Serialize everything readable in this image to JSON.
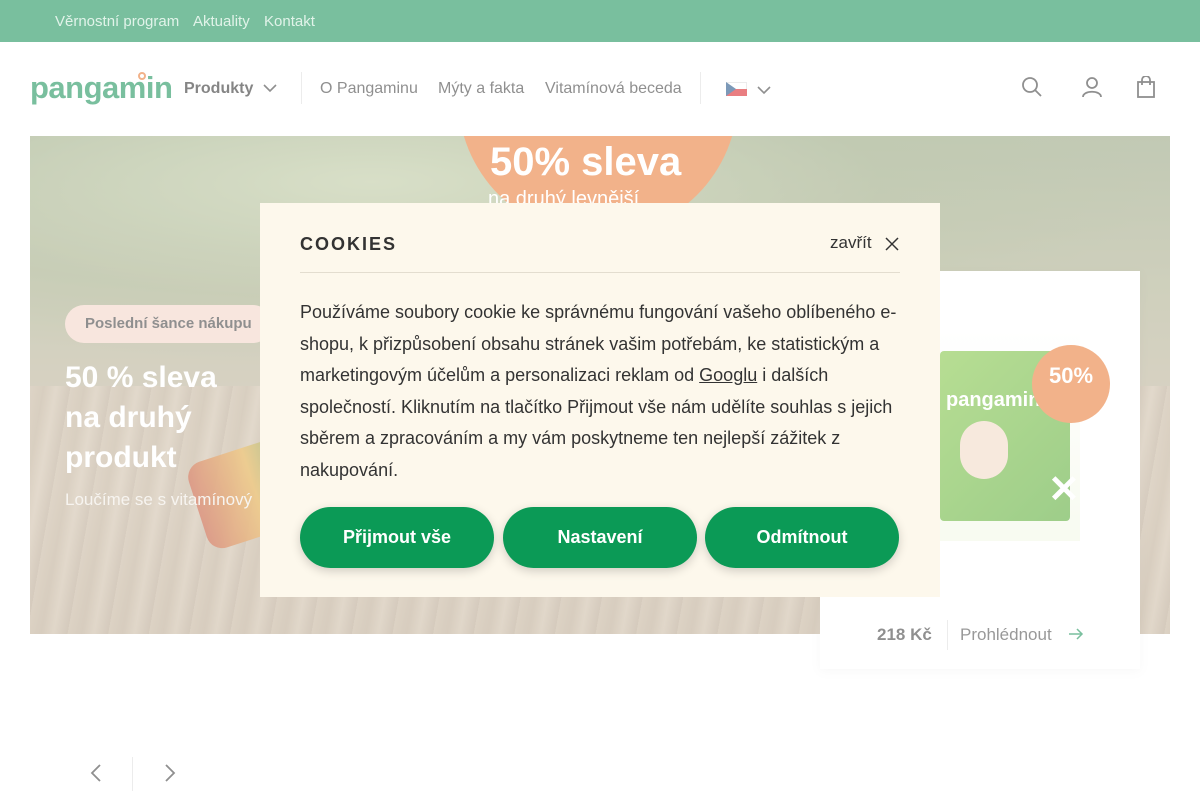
{
  "colors": {
    "brand_green": "#0b8a4f",
    "accent_orange": "#e8742a",
    "button_green": "#0b9a56",
    "modal_bg": "#fdf8ec",
    "tag_bg": "#f3d2c4"
  },
  "topbar": {
    "links": [
      "Věrnostní program",
      "Aktuality",
      "Kontakt"
    ]
  },
  "header": {
    "logo": "pangamin",
    "nav": {
      "products_label": "Produkty",
      "links": [
        "O Pangaminu",
        "Mýty a fakta",
        "Vitamínová beceda"
      ]
    },
    "language": "cs",
    "icons": [
      "search-icon",
      "user-icon",
      "cart-icon"
    ]
  },
  "hero": {
    "badge_line1": "50% sleva",
    "badge_line2": "na druhý levnější",
    "tag": "Poslední šance nákupu",
    "title_lines": [
      "50 % sleva",
      "na druhý",
      "produkt"
    ],
    "subtitle": "Loučíme se s vitamínový"
  },
  "product_card": {
    "image_label": "pangamin",
    "badge": "50%",
    "price": "218 Kč",
    "view_label": "Prohlédnout"
  },
  "cookies": {
    "title": "COOKIES",
    "close_label": "zavřít",
    "text_before_link": "Používáme soubory cookie ke správnému fungování vašeho oblíbeného e-shopu, k přizpůsobení obsahu stránek vašim potřebám, ke statistickým a marketingovým účelům a personalizaci reklam od ",
    "link_text": "Googlu",
    "text_after_link": " i dalších společností. Kliknutím na tlačítko Přijmout vše nám udělíte souhlas s jejich sběrem a zpracováním a my vám poskytneme ten nejlepší zážitek z nakupování.",
    "buttons": {
      "accept_all": "Přijmout vše",
      "settings": "Nastavení",
      "reject": "Odmítnout"
    }
  }
}
